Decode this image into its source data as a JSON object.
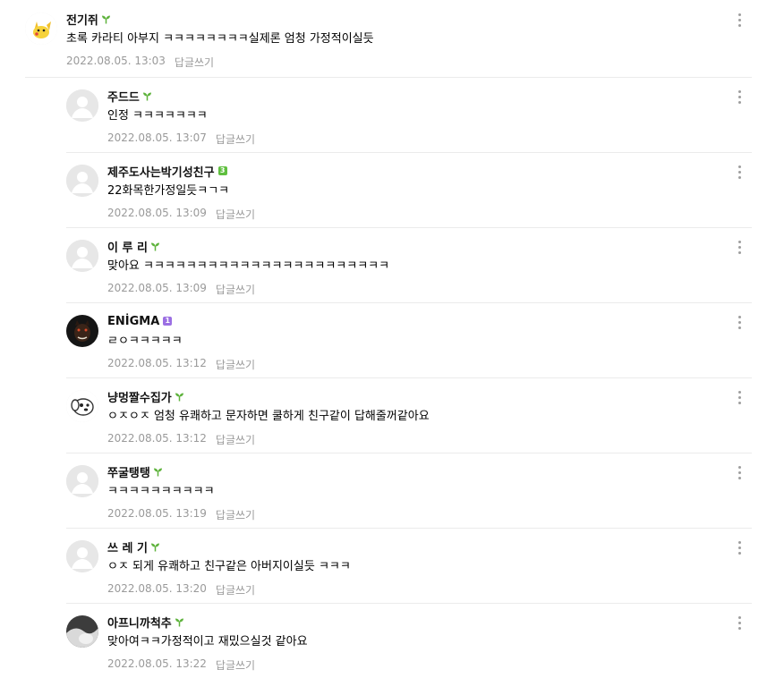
{
  "comments": [
    {
      "author": "전기쥐",
      "badge": "sprout",
      "text": "초록 카라티 아부지 ㅋㅋㅋㅋㅋㅋㅋㅋ실제론 엄청 가정적이실듯",
      "date": "2022.08.05. 13:03",
      "reply_label": "답글쓰기",
      "avatar": "pikachu-avatar"
    },
    {
      "author": "주드드",
      "badge": "sprout",
      "text": "인정 ㅋㅋㅋㅋㅋㅋㅋ",
      "date": "2022.08.05. 13:07",
      "reply_label": "답글쓰기",
      "avatar": "default-avatar"
    },
    {
      "author": "제주도사는박기성친구",
      "badge": "level",
      "badge_text": "3",
      "badge_color": "#5fbf3f",
      "text": "22화목한가정일듯ㅋㄱㅋ",
      "date": "2022.08.05. 13:09",
      "reply_label": "답글쓰기",
      "avatar": "default-avatar"
    },
    {
      "author": "이 루 리",
      "badge": "sprout",
      "text": "맞아요 ㅋㅋㅋㅋㅋㅋㅋㅋㅋㅋㅋㅋㅋㅋㅋㅋㅋㅋㅋㅋㅋㅋㅋ",
      "date": "2022.08.05. 13:09",
      "reply_label": "답글쓰기",
      "avatar": "default-avatar"
    },
    {
      "author": "ENİGMA",
      "badge": "level",
      "badge_text": "1",
      "badge_color": "#9b6fe3",
      "text": "ㄹㅇㅋㅋㅋㅋㅋ",
      "date": "2022.08.05. 13:12",
      "reply_label": "답글쓰기",
      "avatar": "dog-dark-avatar"
    },
    {
      "author": "냥멍짤수집가",
      "badge": "sprout",
      "text": "ㅇㅈㅇㅈ 엄청 유쾌하고 문자하면 쿨하게 친구같이 답해줄꺼같아요",
      "date": "2022.08.05. 13:12",
      "reply_label": "답글쓰기",
      "avatar": "cartoon-dog-avatar"
    },
    {
      "author": "쭈굴탱탱",
      "badge": "sprout",
      "text": "ㅋㅋㅋㅋㅋㅋㅋㅋㅋㅋ",
      "date": "2022.08.05. 13:19",
      "reply_label": "답글쓰기",
      "avatar": "default-avatar"
    },
    {
      "author": "쓰 레 기",
      "badge": "sprout",
      "text": "ㅇㅈ 되게 유쾌하고 친구같은 아버지이실듯 ㅋㅋㅋ",
      "date": "2022.08.05. 13:20",
      "reply_label": "답글쓰기",
      "avatar": "default-avatar"
    },
    {
      "author": "아프니까척추",
      "badge": "sprout",
      "text": "맞아여ㅋㅋ가정적이고 재밌으실것 같아요",
      "date": "2022.08.05. 13:22",
      "reply_label": "답글쓰기",
      "avatar": "photo-avatar"
    }
  ],
  "colors": {
    "sprout": "#5fb33d",
    "meta": "#9a9a9a",
    "divider": "#ebebeb"
  }
}
